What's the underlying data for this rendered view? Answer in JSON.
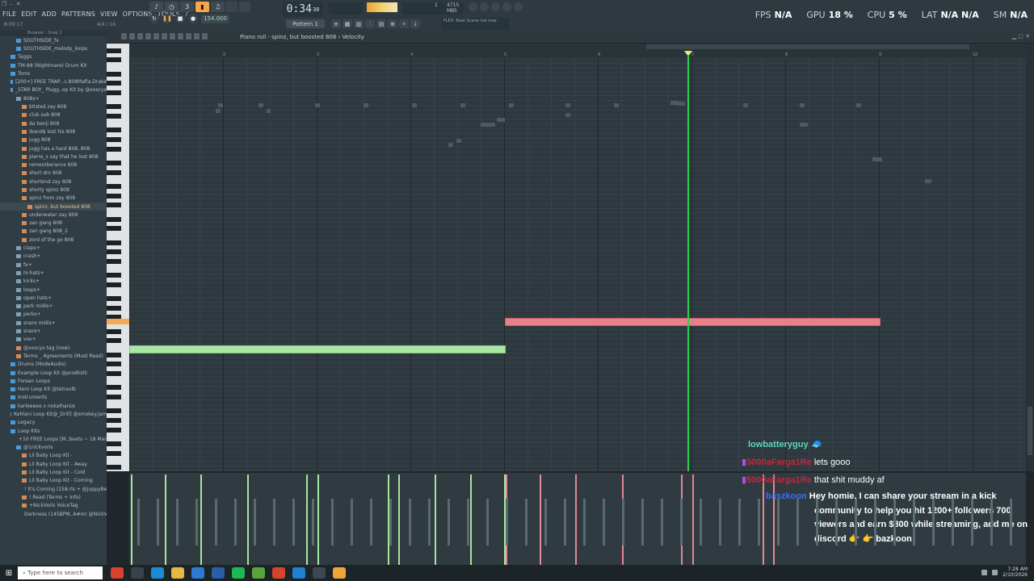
{
  "menu": [
    "FILE",
    "EDIT",
    "ADD",
    "PATTERNS",
    "VIEW",
    "OPTIONS",
    "TOOLS",
    "?"
  ],
  "titlebar": {
    "hint": "8:09:17",
    "hint2": "4/4 / 16"
  },
  "transport": {
    "time_main": "0:34",
    "time_sub": "30",
    "tempo": "154.000",
    "pattern": "Pattern 1",
    "hint": "FLEX: Beat Scene not now"
  },
  "memory": {
    "label": "4715 MB",
    "num1": "1",
    "num2": "5"
  },
  "stats": [
    {
      "label": "FPS",
      "value": "N/A"
    },
    {
      "label": "GPU",
      "value": "18 %"
    },
    {
      "label": "CPU",
      "value": "5 %"
    },
    {
      "label": "LAT",
      "value": "N/A N/A"
    },
    {
      "label": "SM",
      "value": "N/A"
    }
  ],
  "browser": {
    "header": "Browser - Snap 2",
    "items": [
      {
        "label": "SOUTHSIDE_fx",
        "kind": "folder",
        "indent": 2
      },
      {
        "label": "SOUTHSIDE_melody_loops",
        "kind": "folder",
        "indent": 2
      },
      {
        "label": "Taggs",
        "kind": "folder",
        "indent": 1
      },
      {
        "label": "TM-88 (Nightmare) Drum Kit",
        "kind": "folder",
        "indent": 1
      },
      {
        "label": "Toms",
        "kind": "folder",
        "indent": 1
      },
      {
        "label": "[200+] FREE TRAP...c.808Mafia.Drake",
        "kind": "folder",
        "indent": 1
      },
      {
        "label": "_STAR BOY_ Plugg..op Kit by @xxscyx",
        "kind": "folder",
        "indent": 1
      },
      {
        "label": "808s+",
        "kind": "pack",
        "indent": 2
      },
      {
        "label": "b0sted zay 808",
        "kind": "file",
        "indent": 3
      },
      {
        "label": "club sub 808",
        "kind": "file",
        "indent": 3
      },
      {
        "label": "da benji 808",
        "kind": "file",
        "indent": 3
      },
      {
        "label": "iband$ lost his 808",
        "kind": "file",
        "indent": 3
      },
      {
        "label": "jugg 808",
        "kind": "file",
        "indent": 3
      },
      {
        "label": "jugg has a hard 808, 808",
        "kind": "file",
        "indent": 3
      },
      {
        "label": "pierre_s say that he lost 808",
        "kind": "file",
        "indent": 3
      },
      {
        "label": "rememberance 808",
        "kind": "file",
        "indent": 3
      },
      {
        "label": "short dro 808",
        "kind": "file",
        "indent": 3
      },
      {
        "label": "shortend zay 808",
        "kind": "file",
        "indent": 3
      },
      {
        "label": "shorty spinz 808",
        "kind": "file",
        "indent": 3
      },
      {
        "label": "spinz from zay 808",
        "kind": "file",
        "indent": 3
      },
      {
        "label": "spinz, but boosted 808",
        "kind": "file",
        "indent": 4,
        "selected": true
      },
      {
        "label": "underwater zay 808",
        "kind": "file",
        "indent": 3
      },
      {
        "label": "zan gang 808",
        "kind": "file",
        "indent": 3
      },
      {
        "label": "zan gang 808_2",
        "kind": "file",
        "indent": 3
      },
      {
        "label": "zord of the go 808",
        "kind": "file",
        "indent": 3
      },
      {
        "label": "claps+",
        "kind": "pack",
        "indent": 2
      },
      {
        "label": "crash+",
        "kind": "pack",
        "indent": 2
      },
      {
        "label": "fx+",
        "kind": "pack",
        "indent": 2
      },
      {
        "label": "hi-hats+",
        "kind": "pack",
        "indent": 2
      },
      {
        "label": "kicks+",
        "kind": "pack",
        "indent": 2
      },
      {
        "label": "loops+",
        "kind": "pack",
        "indent": 2
      },
      {
        "label": "open hats+",
        "kind": "pack",
        "indent": 2
      },
      {
        "label": "perk midis+",
        "kind": "pack",
        "indent": 2
      },
      {
        "label": "perks+",
        "kind": "pack",
        "indent": 2
      },
      {
        "label": "snare midis+",
        "kind": "pack",
        "indent": 2
      },
      {
        "label": "snare+",
        "kind": "pack",
        "indent": 2
      },
      {
        "label": "vox+",
        "kind": "pack",
        "indent": 2
      },
      {
        "label": "@xxscyx tag (new)",
        "kind": "file",
        "indent": 2
      },
      {
        "label": "Terms _ Agreements (Must Read)",
        "kind": "file",
        "indent": 2
      },
      {
        "label": "Drums (ModeAudio)",
        "kind": "folder",
        "indent": 1
      },
      {
        "label": "Example Loop Kit @prodkshl",
        "kind": "folder",
        "indent": 1
      },
      {
        "label": "Forean Loops",
        "kind": "folder",
        "indent": 1
      },
      {
        "label": "Hero Loop Kit @tetraolb",
        "kind": "folder",
        "indent": 1
      },
      {
        "label": "Instruments",
        "kind": "folder",
        "indent": 1
      },
      {
        "label": "karleeeee x nokalharsis",
        "kind": "folder",
        "indent": 1
      },
      {
        "label": "Kehlani Loop Kit@_Drill] @smokey.jam",
        "kind": "folder",
        "indent": 1
      },
      {
        "label": "Legacy",
        "kind": "folder",
        "indent": 1
      },
      {
        "label": "Loop Kits",
        "kind": "folder",
        "indent": 1
      },
      {
        "label": "+10 FREE Loops [M..beats ~ 18 March",
        "kind": "folder",
        "indent": 2
      },
      {
        "label": "@1nickvoris",
        "kind": "folder",
        "indent": 2
      },
      {
        "label": "Lil Baby Loop Kit -",
        "kind": "file",
        "indent": 3
      },
      {
        "label": "Lil Baby Loop Kit - Away",
        "kind": "file",
        "indent": 3
      },
      {
        "label": "Lil Baby Loop Kit - Cold",
        "kind": "file",
        "indent": 3
      },
      {
        "label": "Lil Baby Loop Kit - Coming",
        "kind": "file",
        "indent": 3
      },
      {
        "label": "! It's Coming (158.rls + @juppyBeats",
        "kind": "file",
        "indent": 3
      },
      {
        "label": "! Read (Terms + Info)",
        "kind": "file",
        "indent": 3
      },
      {
        "label": "+NickVoris VoiceTag",
        "kind": "file",
        "indent": 3
      },
      {
        "label": "Darkness (145BPM, A#m) @NickVoris",
        "kind": "file",
        "indent": 3
      }
    ]
  },
  "pianoroll": {
    "title": "Piano roll - spinz, but boosted 808 › Velocity",
    "ruler": [
      "2",
      "3",
      "4",
      "5",
      "6",
      "7",
      "8",
      "9",
      "10"
    ]
  },
  "chat": [
    {
      "user": "lowbatteryguy",
      "color": "#5fd3b8",
      "text": ""
    },
    {
      "user": "5000aFarga1Re",
      "color": "#c2283a",
      "text": "lets gooo"
    },
    {
      "user": "5000aFarga1Re",
      "color": "#c2283a",
      "text": "that shit muddy af"
    },
    {
      "user": "baszkoon",
      "color": "#3f6ff0",
      "text": "Hey homie, I can share your stream in a kick"
    },
    {
      "user": "",
      "color": "#ffffff",
      "text": "community to help you hit 1200+ followers 700"
    },
    {
      "user": "",
      "color": "#ffffff",
      "text": "viewers and earn $800 while streaming, add me on"
    },
    {
      "user": "",
      "color": "#ffffff",
      "text": "discord 👉 👉 bazkoon"
    }
  ],
  "taskbar": {
    "search_placeholder": "Type here to search",
    "time": "7:28 AM",
    "date": "2/10/2026"
  },
  "colors": {
    "accent": "#f7a64b",
    "playhead": "#2fcf4a",
    "note_red": "#e8808a",
    "note_green": "#a9e6a4"
  }
}
